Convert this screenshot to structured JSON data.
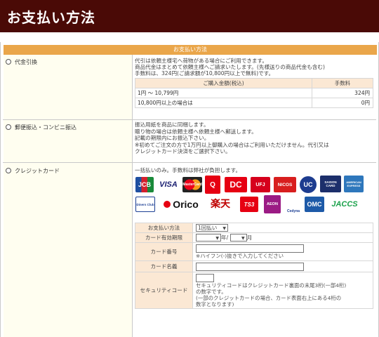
{
  "header": {
    "title": "お支払い方法"
  },
  "caption": "お支払い方法",
  "methods": [
    {
      "label": "代金引換"
    },
    {
      "label": "郵便振込・コンビニ振込"
    },
    {
      "label": "クレジットカード"
    }
  ],
  "cod": {
    "line1": "代引は依頼主様宅へ荷物がある場合にご利用できます。",
    "line2": "商品代金はまとめて依頼主様へご請求いたします。(先様送りの商品代金も含む)",
    "line3": "手数料は、324円(ご請求額が10,800円以上で無料)です。",
    "table_headers": [
      "ご購入金額(税込)",
      "手数料"
    ],
    "rows": [
      {
        "range": "1円 ～ 10,799円",
        "fee": "324円"
      },
      {
        "range": "10,800円以上の場合は",
        "fee": "0円"
      }
    ]
  },
  "postal": {
    "line1": "振込用紙を商品に同梱します。",
    "line2": "贈り物の場合は依頼主様へ依頼主様へ郵送します。",
    "line3": "記載の期限内にお振込下さい。",
    "line4": "※初めてご注文の方で1万円以上御購入の場合はご利用いただけません。代引又は",
    "line5": "クレジットカード決済をご選択下さい。"
  },
  "credit": {
    "intro": "一括払いのみ。手数料は弊社が負担します。",
    "logos_row1": [
      "JCB",
      "VISA",
      "MasterCard",
      "Q",
      "DC",
      "UFJ",
      "NICOS",
      "UC",
      "SAISON CARD",
      "AMERICAN EXPRESS"
    ],
    "logos_row2": [
      "Diners Club",
      "Orico",
      "楽天",
      "TS3",
      "AEON",
      "Cedyna",
      "OMC",
      "JACCS"
    ],
    "form": {
      "payment_label": "お支払い方法",
      "payment_value": "1回払い",
      "expiry_label": "カード有効期限",
      "year_suffix": "年/",
      "month_suffix": "月",
      "number_label": "カード番号",
      "number_note": "※ハイフン(-)抜きで入力してください",
      "name_label": "カード名義",
      "cvc_label": "セキュリティコード",
      "cvc_note1": "セキュリティコードはクレジットカード裏面の末尾3桁(一部4桁)",
      "cvc_note2": "の数字です。",
      "cvc_note3": "(一部のクレジットカードの場合、カード表面右上にある4桁の",
      "cvc_note4": "数字となります)"
    }
  },
  "colors": {
    "header_bg": "#4a0a06",
    "caption_bg": "#eaa64a",
    "label_bg": "#fffef0",
    "table_header_bg": "#fbe8d4"
  }
}
